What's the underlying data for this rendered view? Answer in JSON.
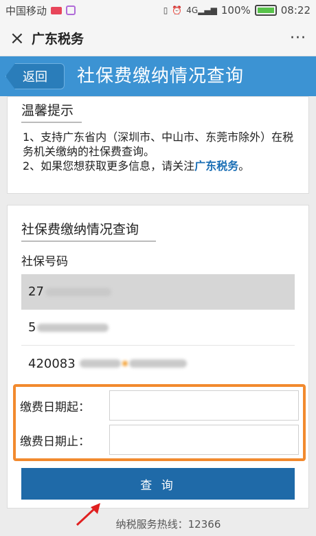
{
  "status_bar": {
    "carrier": "中国移动",
    "battery": "100%",
    "time": "08:22",
    "signal": "4G"
  },
  "nav": {
    "close_icon": "×",
    "title": "广东税务",
    "more_icon": "···"
  },
  "header": {
    "back_label": "返回",
    "title": "社保费缴纳情况查询"
  },
  "tips": {
    "title": "温馨提示",
    "line1": "1、支持广东省内（深圳市、中山市、东莞市除外）在税务机关缴纳的社保费查询。",
    "line2_prefix": "2、如果您想获取更多信息，请关注",
    "line2_link": "广东税务",
    "line2_suffix": "。"
  },
  "query": {
    "title": "社保费缴纳情况查询",
    "ssn_label": "社保号码",
    "ssn_items": [
      "27",
      "5",
      "420083"
    ],
    "start_date_label": "缴费日期起：",
    "end_date_label": "缴费日期止：",
    "submit_label": "查 询"
  },
  "footer": {
    "hotline": "纳税服务热线：12366"
  },
  "colors": {
    "header_bg": "#3c93d3",
    "button_bg": "#1f6aa8",
    "highlight_border": "#f28a2e",
    "link": "#1b6fb5"
  }
}
